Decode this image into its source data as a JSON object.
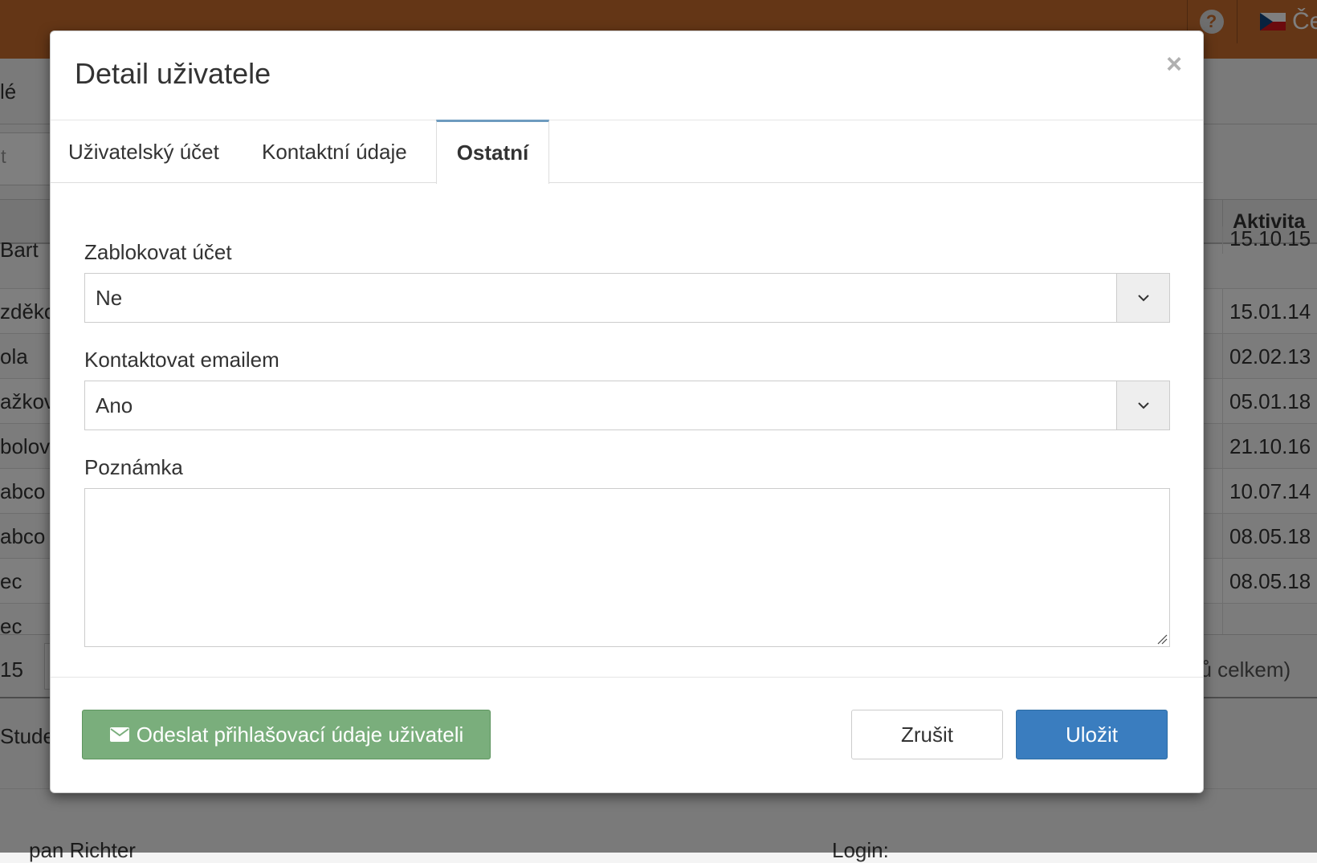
{
  "background": {
    "lang_label": "Če",
    "help_label": "?",
    "subnav_text": "lé",
    "filter_text": "t",
    "column_activity": "Aktivita",
    "rows": [
      {
        "name": "Bart",
        "activity": "15.10.15"
      },
      {
        "name": "zděko",
        "activity": "15.01.14"
      },
      {
        "name": "ola",
        "activity": "02.02.13"
      },
      {
        "name": "ažkov",
        "activity": "05.01.18"
      },
      {
        "name": "bolov",
        "activity": "21.10.16"
      },
      {
        "name": "abco",
        "activity": "10.07.14"
      },
      {
        "name": "abco",
        "activity": "08.05.18"
      },
      {
        "name": "ec",
        "activity": "08.05.18"
      },
      {
        "name": "ec",
        "activity": ""
      }
    ],
    "pager_size": "15",
    "pager_total": "nů celkem)",
    "lower_tab": "Stude",
    "lower_name": "pan Richter",
    "lower_login": "Login:"
  },
  "modal": {
    "title": "Detail uživatele",
    "close": "×",
    "tabs": [
      {
        "label": "Uživatelský účet",
        "active": false
      },
      {
        "label": "Kontaktní údaje",
        "active": false
      },
      {
        "label": "Ostatní",
        "active": true
      }
    ],
    "fields": {
      "block": {
        "label": "Zablokovat účet",
        "value": "Ne"
      },
      "contact": {
        "label": "Kontaktovat emailem",
        "value": "Ano"
      },
      "note": {
        "label": "Poznámka",
        "value": ""
      }
    },
    "buttons": {
      "send_label": "Odeslat přihlašovací údaje uživateli",
      "cancel_label": "Zrušit",
      "save_label": "Uložit"
    },
    "icons": {
      "send": "envelope-icon",
      "close": "close-icon",
      "select": "chevron-down-icon"
    },
    "colors": {
      "send_button": "#7aae7c",
      "save_button": "#3a7dbf",
      "active_tab_border": "#6e9bbf",
      "topbar": "#c86d2c"
    }
  }
}
